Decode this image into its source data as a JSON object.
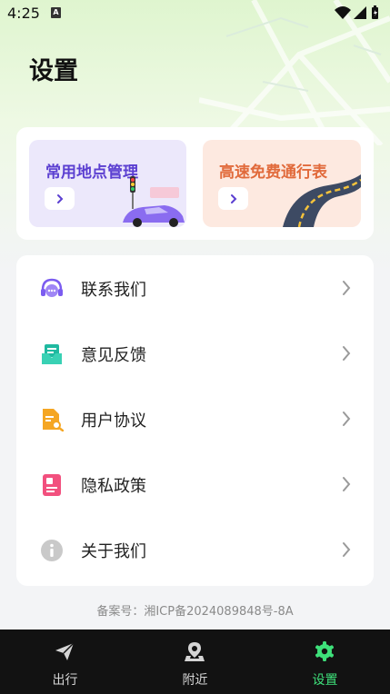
{
  "status_bar": {
    "time": "4:25",
    "sim_label": "A"
  },
  "page": {
    "title": "设置"
  },
  "shortcuts": [
    {
      "label": "常用地点管理",
      "icon": "chevron-right-icon"
    },
    {
      "label": "高速免费通行表",
      "icon": "chevron-right-icon"
    }
  ],
  "menu": [
    {
      "label": "联系我们",
      "icon": "headset-chat-icon"
    },
    {
      "label": "意见反馈",
      "icon": "feedback-inbox-icon"
    },
    {
      "label": "用户协议",
      "icon": "document-search-icon"
    },
    {
      "label": "隐私政策",
      "icon": "privacy-card-icon"
    },
    {
      "label": "关于我们",
      "icon": "info-icon"
    }
  ],
  "footer": {
    "icp": "备案号：湘ICP备2024089848号-8A"
  },
  "tabs": [
    {
      "label": "出行",
      "icon": "paper-plane-icon",
      "active": false
    },
    {
      "label": "附近",
      "icon": "map-pin-icon",
      "active": false
    },
    {
      "label": "设置",
      "icon": "gear-icon",
      "active": true
    }
  ],
  "colors": {
    "accent_green": "#3ee07a",
    "tile1_bg": "#ece8fb",
    "tile1_text": "#5b3fd1",
    "tile2_bg": "#fde9e0",
    "tile2_text": "#e16a3b",
    "tabbar_bg": "#121212"
  }
}
